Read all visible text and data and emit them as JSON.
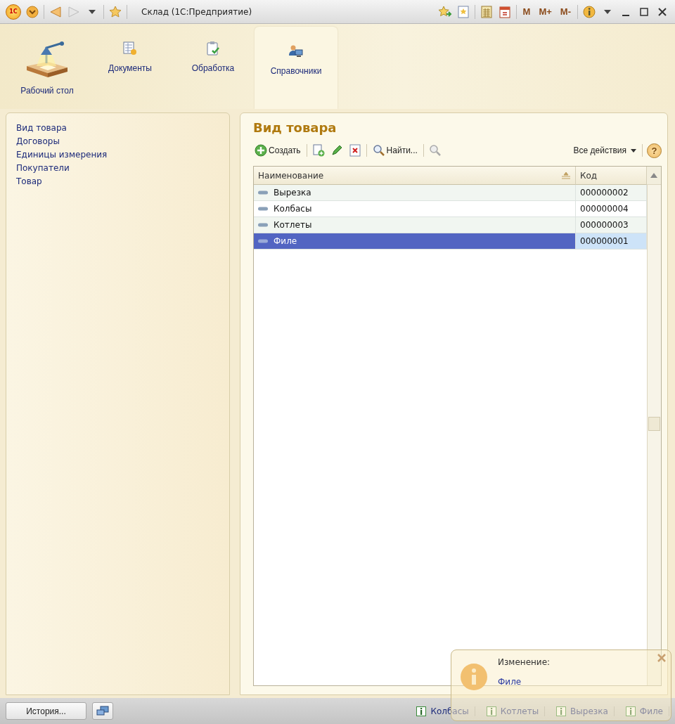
{
  "window": {
    "logo": "1С",
    "title": "Склад  (1С:Предприятие)"
  },
  "memory_buttons": [
    "M",
    "M+",
    "M-"
  ],
  "sections": [
    {
      "label": "Рабочий стол",
      "kind": "desk",
      "selected": false
    },
    {
      "label": "Документы",
      "kind": "documents",
      "selected": false
    },
    {
      "label": "Обработка",
      "kind": "processing",
      "selected": false
    },
    {
      "label": "Справочники",
      "kind": "catalogs",
      "selected": true
    }
  ],
  "nav": {
    "items": [
      "Вид товара",
      "Договоры",
      "Единицы измерения",
      "Покупатели",
      "Товар"
    ]
  },
  "form": {
    "title": "Вид товара",
    "toolbar": {
      "create": "Создать",
      "find": "Найти...",
      "all_actions": "Все действия",
      "help": "?"
    },
    "table": {
      "columns": [
        "Наименование",
        "Код"
      ],
      "rows": [
        {
          "name": "Вырезка",
          "code": "000000002",
          "selected": false
        },
        {
          "name": "Колбасы",
          "code": "000000004",
          "selected": false
        },
        {
          "name": "Котлеты",
          "code": "000000003",
          "selected": false
        },
        {
          "name": "Филе",
          "code": "000000001",
          "selected": true
        }
      ]
    }
  },
  "status_bar": {
    "history_button": "История...",
    "recent": [
      "Колбасы",
      "Котлеты",
      "Вырезка",
      "Филе"
    ]
  },
  "notification": {
    "title": "Изменение:",
    "link": "Филе"
  }
}
